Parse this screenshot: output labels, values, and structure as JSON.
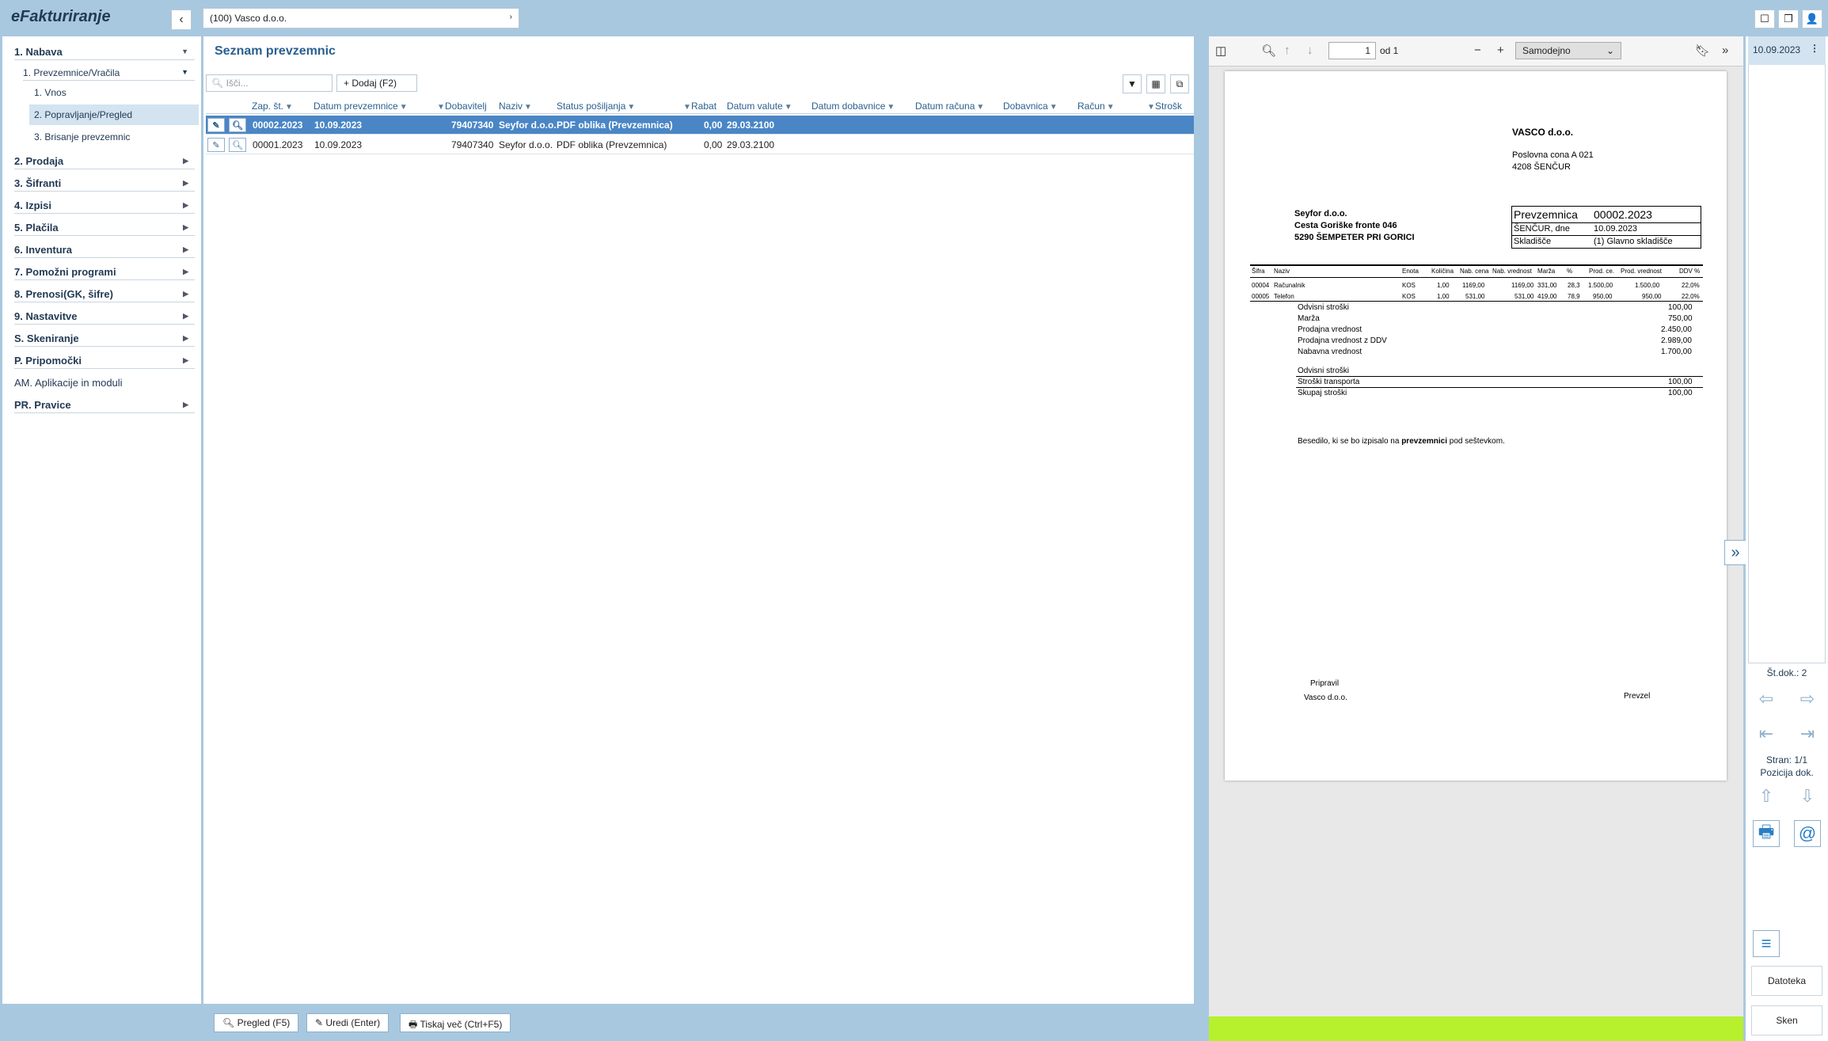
{
  "app": {
    "title": "eFakturiranje",
    "company": "(100) Vasco d.o.o."
  },
  "sidebar": {
    "items": [
      {
        "label": "1. Nabava"
      },
      {
        "label": "2. Prodaja"
      },
      {
        "label": "3. Šifranti"
      },
      {
        "label": "4. Izpisi"
      },
      {
        "label": "5. Plačila"
      },
      {
        "label": "6. Inventura"
      },
      {
        "label": "7. Pomožni programi"
      },
      {
        "label": "8. Prenosi(GK, šifre)"
      },
      {
        "label": "9. Nastavitve"
      },
      {
        "label": "S. Skeniranje"
      },
      {
        "label": "P. Pripomočki"
      },
      {
        "label": "AM. Aplikacije in moduli"
      },
      {
        "label": "PR. Pravice"
      }
    ],
    "sub": {
      "label": "1. Prevzemnice/Vračila"
    },
    "leaves": [
      {
        "label": "1. Vnos"
      },
      {
        "label": "2. Popravljanje/Pregled"
      },
      {
        "label": "3. Brisanje prevzemnic"
      }
    ]
  },
  "main": {
    "title": "Seznam prevzemnic",
    "search_placeholder": "Išči...",
    "add_label": "Dodaj (F2)",
    "columns": [
      "Zap. št.",
      "Datum prevzemnice",
      "Dobavitelj",
      "Naziv",
      "Status pošiljanja",
      "Rabat",
      "Datum valute",
      "Datum dobavnice",
      "Datum računa",
      "Dobavnica",
      "Račun",
      "Strošk"
    ],
    "rows": [
      {
        "zap": "00002.2023",
        "datum": "10.09.2023",
        "dobavitelj": "79407340",
        "naziv": "Seyfor d.o.o.",
        "status": "PDF oblika (Prevzemnica)",
        "rabat": "0,00",
        "valuta": "29.03.2100"
      },
      {
        "zap": "00001.2023",
        "datum": "10.09.2023",
        "dobavitelj": "79407340",
        "naziv": "Seyfor d.o.o.",
        "status": "PDF oblika (Prevzemnica)",
        "rabat": "0,00",
        "valuta": "29.03.2100"
      }
    ],
    "bottom_buttons": [
      "Pregled (F5)",
      "Uredi (Enter)",
      "Tiskaj več (Ctrl+F5)"
    ]
  },
  "viewer": {
    "page": "1",
    "page_of": "od 1",
    "zoom": "Samodejno",
    "pdf": {
      "company": "VASCO d.o.o.",
      "company_addr1": "Poslovna cona A 021",
      "company_addr2": "4208 ŠENČUR",
      "buyer": "Seyfor d.o.o.",
      "buyer_addr1": "Cesta Goriške fronte 046",
      "buyer_addr2": "5290 ŠEMPETER PRI GORICI",
      "doc_label": "Prevzemnica",
      "doc_number": "00002.2023",
      "place_label": "ŠENČUR, dne",
      "place_date": "10.09.2023",
      "store_label": "Skladišče",
      "store_value": "(1) Glavno skladišče",
      "table_headers": [
        "Šifra",
        "Naziv",
        "Enota",
        "Količina",
        "Nab. cena",
        "Nab. vrednost",
        "Marža",
        "%",
        "Prod. ce.",
        "Prod. vrednost",
        "DDV %"
      ],
      "table_rows": [
        [
          "00004",
          "Računalnik",
          "KOS",
          "1,00",
          "1169,00",
          "1169,00",
          "331,00",
          "28,3",
          "1.500,00",
          "1.500,00",
          "22,0%"
        ],
        [
          "00005",
          "Telefon",
          "KOS",
          "1,00",
          "531,00",
          "531,00",
          "419,00",
          "78,9",
          "950,00",
          "950,00",
          "22,0%"
        ]
      ],
      "summary": [
        {
          "label": "Odvisni stroški",
          "value": "100,00"
        },
        {
          "label": "Marža",
          "value": "750,00"
        },
        {
          "label": "Prodajna vrednost",
          "value": "2.450,00"
        },
        {
          "label": "Prodajna vrednost z DDV",
          "value": "2.989,00"
        },
        {
          "label": "Nabavna vrednost",
          "value": "1.700,00"
        }
      ],
      "costs_title": "Odvisni stroški",
      "costs": [
        {
          "label": "Stroški transporta",
          "value": "100,00"
        },
        {
          "label": "Skupaj stroški",
          "value": "100,00"
        }
      ],
      "note_pre": "Besedilo, ki se bo izpisalo na ",
      "note_bold": "prevzemnici",
      "note_post": " pod seštevkom.",
      "prepared_label": "Pripravil",
      "prepared_by": "Vasco d.o.o.",
      "received_label": "Prevzel"
    }
  },
  "right_panel": {
    "doc_date": "10.09.2023",
    "doc_count": "Št.dok.: 2",
    "page_info": "Stran: 1/1",
    "position_label": "Pozicija dok.",
    "file_button": "Datoteka",
    "scan_button": "Sken"
  }
}
